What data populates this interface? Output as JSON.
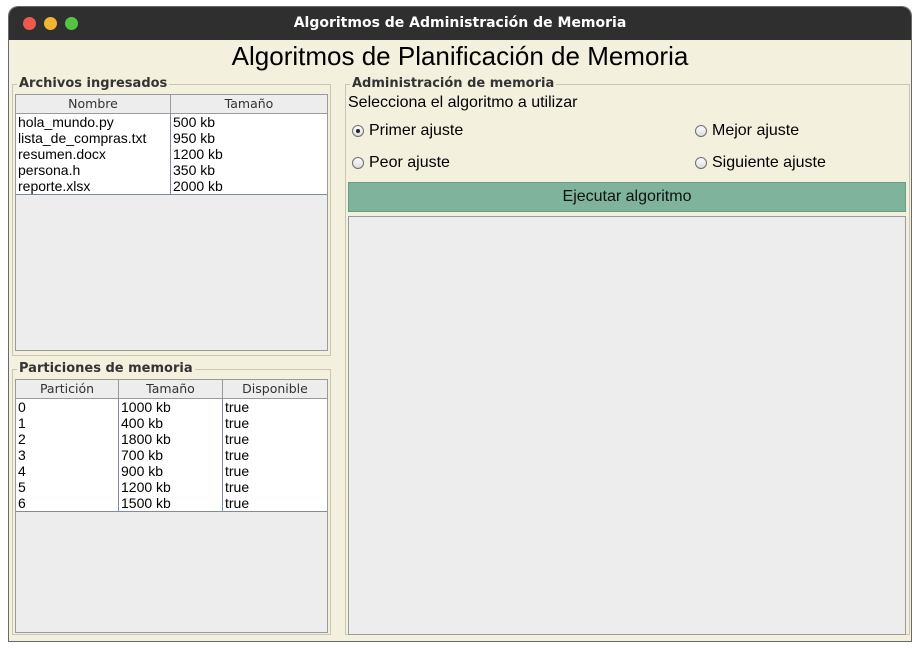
{
  "window": {
    "title": "Algoritmos de Administración de Memoria",
    "heading": "Algoritmos de Planificación de Memoria"
  },
  "files_panel": {
    "title": "Archivos ingresados",
    "columns": [
      "Nombre",
      "Tamaño"
    ],
    "rows": [
      [
        "hola_mundo.py",
        "500 kb"
      ],
      [
        "lista_de_compras.txt",
        "950 kb"
      ],
      [
        "resumen.docx",
        "1200 kb"
      ],
      [
        "persona.h",
        "350 kb"
      ],
      [
        "reporte.xlsx",
        "2000 kb"
      ]
    ]
  },
  "partitions_panel": {
    "title": "Particiones de memoria",
    "columns": [
      "Partición",
      "Tamaño",
      "Disponible"
    ],
    "rows": [
      [
        "0",
        "1000 kb",
        "true"
      ],
      [
        "1",
        "400 kb",
        "true"
      ],
      [
        "2",
        "1800 kb",
        "true"
      ],
      [
        "3",
        "700 kb",
        "true"
      ],
      [
        "4",
        "900 kb",
        "true"
      ],
      [
        "5",
        "1200 kb",
        "true"
      ],
      [
        "6",
        "1500 kb",
        "true"
      ]
    ]
  },
  "admin_panel": {
    "title": "Administración de memoria",
    "prompt": "Selecciona el algoritmo a utilizar",
    "options": [
      {
        "label": "Primer ajuste",
        "selected": true
      },
      {
        "label": "Mejor ajuste",
        "selected": false
      },
      {
        "label": "Peor ajuste",
        "selected": false
      },
      {
        "label": "Siguiente ajuste",
        "selected": false
      }
    ],
    "run_button": "Ejecutar algoritmo"
  },
  "colors": {
    "background": "#f4f0de",
    "titlebar": "#2f2f2f",
    "button": "#7fb39b"
  }
}
